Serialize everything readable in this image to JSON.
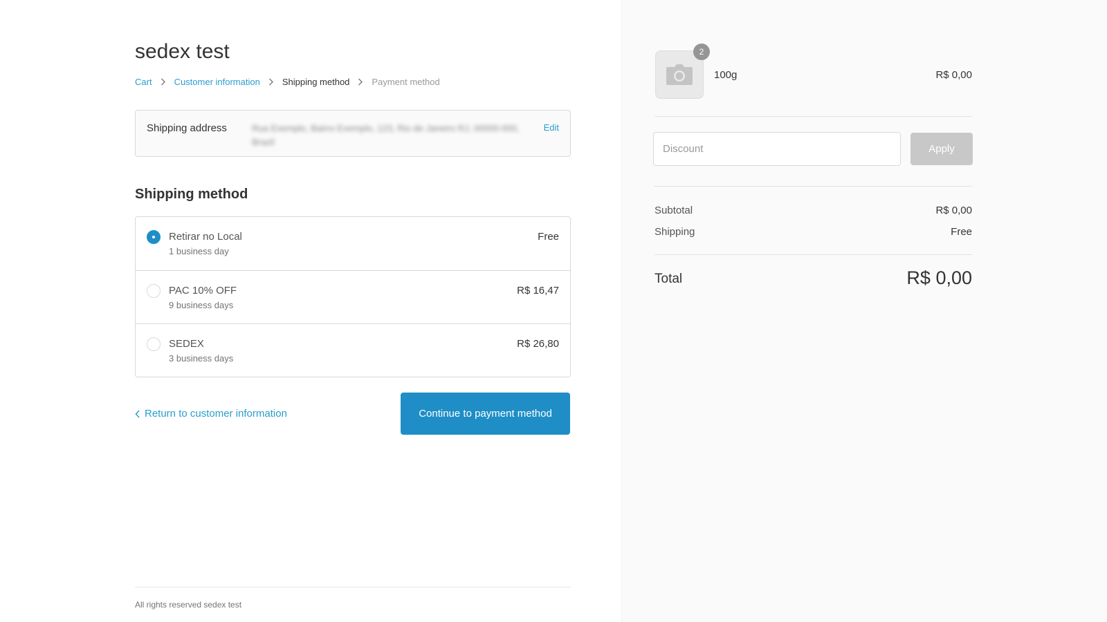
{
  "shop": {
    "name": "sedex test"
  },
  "breadcrumb": {
    "items": [
      {
        "label": "Cart",
        "state": "link"
      },
      {
        "label": "Customer information",
        "state": "link"
      },
      {
        "label": "Shipping method",
        "state": "current"
      },
      {
        "label": "Payment method",
        "state": "future"
      }
    ],
    "separator_icon": "chevron-right-icon"
  },
  "address": {
    "label": "Shipping address",
    "value": "Rua Exemplo, Bairro Exemplo, 123, Rio de Janeiro RJ, 00000-000, Brazil",
    "value_blurred": true,
    "edit_label": "Edit"
  },
  "shipping": {
    "title": "Shipping method",
    "methods": [
      {
        "name": "Retirar no Local",
        "days": "1 business day",
        "price": "Free",
        "selected": true
      },
      {
        "name": "PAC 10% OFF",
        "days": "9 business days",
        "price": "R$ 16,47",
        "selected": false
      },
      {
        "name": "SEDEX",
        "days": "3 business days",
        "price": "R$ 26,80",
        "selected": false
      }
    ]
  },
  "actions": {
    "return_label": "Return to customer information",
    "continue_label": "Continue to payment method"
  },
  "footer": {
    "text": "All rights reserved sedex test"
  },
  "summary": {
    "product": {
      "thumbnail_icon": "camera-icon",
      "quantity": "2",
      "name": "100g",
      "price": "R$ 0,00"
    },
    "discount": {
      "placeholder": "Discount",
      "value": "",
      "apply_label": "Apply"
    },
    "subtotal_label": "Subtotal",
    "subtotal_value": "R$ 0,00",
    "shipping_label": "Shipping",
    "shipping_value": "Free",
    "total_label": "Total",
    "total_value": "R$ 0,00"
  },
  "colors": {
    "accent": "#1f8ec6",
    "link": "#2a9dcc",
    "sidebar_bg": "#fafafa",
    "apply_disabled": "#c8c8c8"
  }
}
